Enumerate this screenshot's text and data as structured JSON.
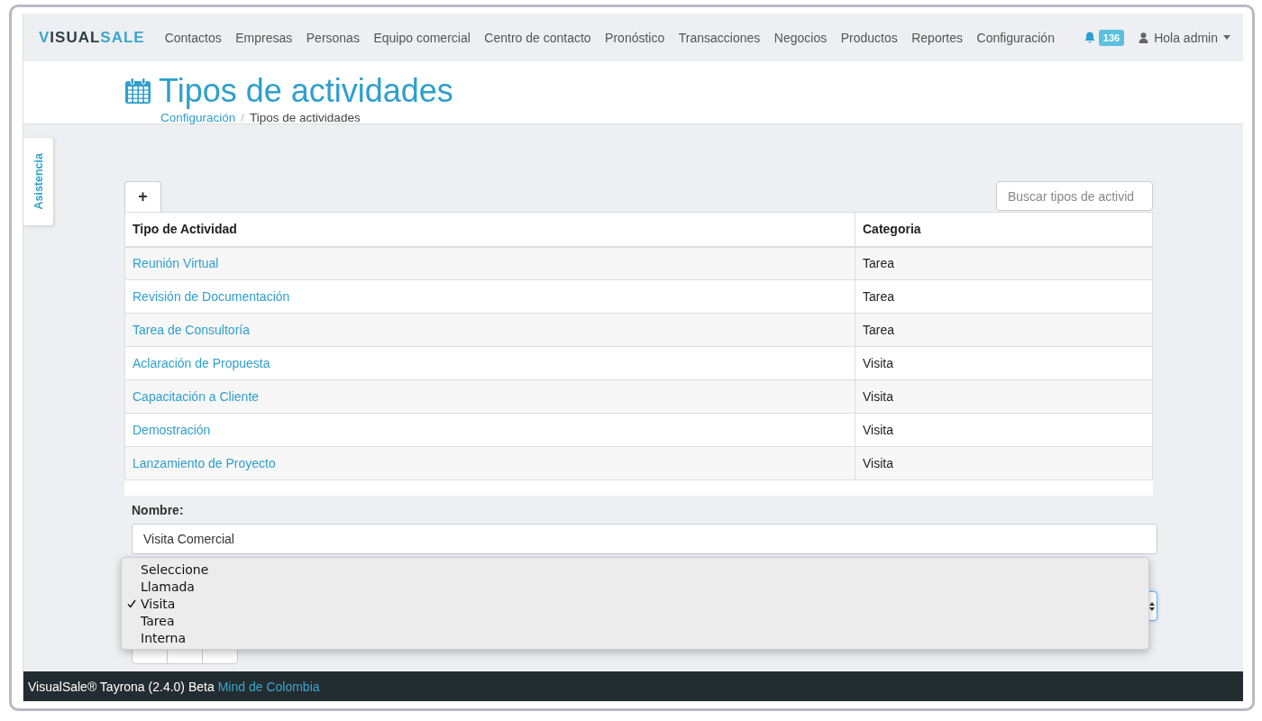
{
  "navbar": {
    "logo": [
      "VISUAL",
      "SALE"
    ],
    "items": [
      "Contactos",
      "Empresas",
      "Personas",
      "Equipo comercial",
      "Centro de contacto",
      "Pronóstico",
      "Transacciones",
      "Negocios",
      "Productos",
      "Reportes",
      "Configuración"
    ],
    "notifications": "136",
    "user": "Hola admin"
  },
  "header": {
    "title": "Tipos de actividades",
    "breadcrumb": [
      {
        "label": "Configuración",
        "link": true
      },
      {
        "label": "Tipos de actividades",
        "link": false
      }
    ],
    "separator": "/"
  },
  "side_tab": "Asistencia",
  "toolbar": {
    "add_button": "+",
    "search": {
      "placeholder": "Buscar tipos de activid"
    }
  },
  "table": {
    "columns": [
      "Tipo de Actividad",
      "Categoria"
    ],
    "rows": [
      [
        "Reunión Virtual",
        "Tarea"
      ],
      [
        "Revisión de Documentación",
        "Tarea"
      ],
      [
        "Tarea de Consultoría",
        "Tarea"
      ],
      [
        "Aclaración de Propuesta",
        "Visita"
      ],
      [
        "Capacitación a Cliente",
        "Visita"
      ],
      [
        "Demostración",
        "Visita"
      ],
      [
        "Lanzamiento de Proyecto",
        "Visita"
      ]
    ]
  },
  "form": {
    "name_label": "Nombre:",
    "name_value": "Visita Comercial"
  },
  "dropdown": {
    "options": [
      {
        "label": "Seleccione",
        "selected": false
      },
      {
        "label": "Llamada",
        "selected": false
      },
      {
        "label": "Visita",
        "selected": true
      },
      {
        "label": "Tarea",
        "selected": false
      },
      {
        "label": "Interna",
        "selected": false
      }
    ]
  },
  "footer": {
    "text": "VisualSale® Tayrona (2.4.0) Beta",
    "link": "Mind de Colombia"
  }
}
